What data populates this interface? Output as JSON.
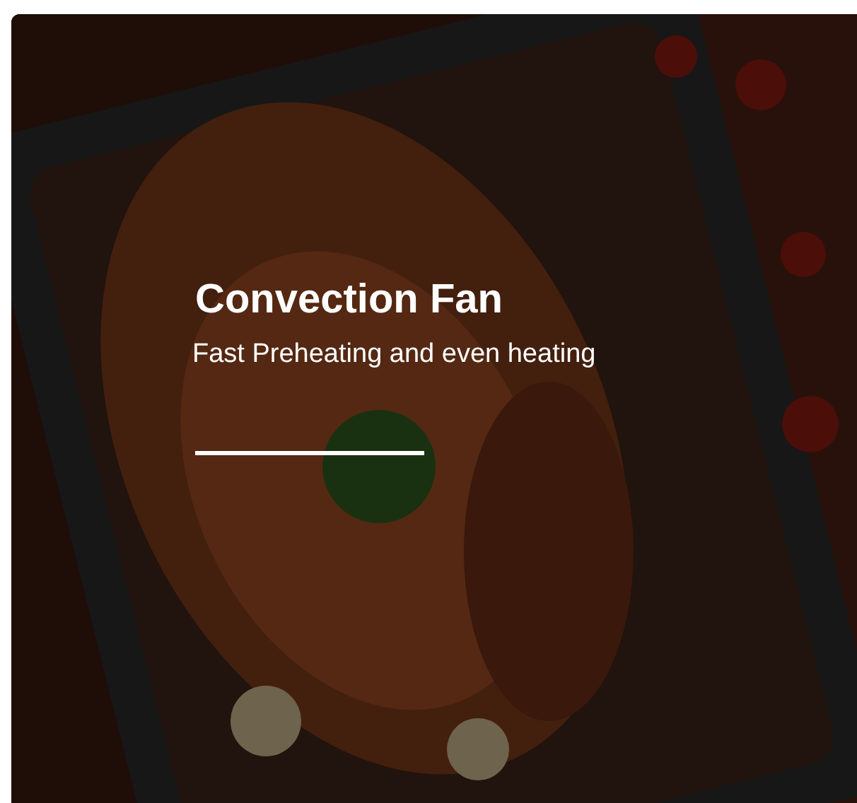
{
  "card": {
    "kind": "picture",
    "title": "Convection Fan",
    "subtitle": "Fast Preheating and even heating"
  }
}
